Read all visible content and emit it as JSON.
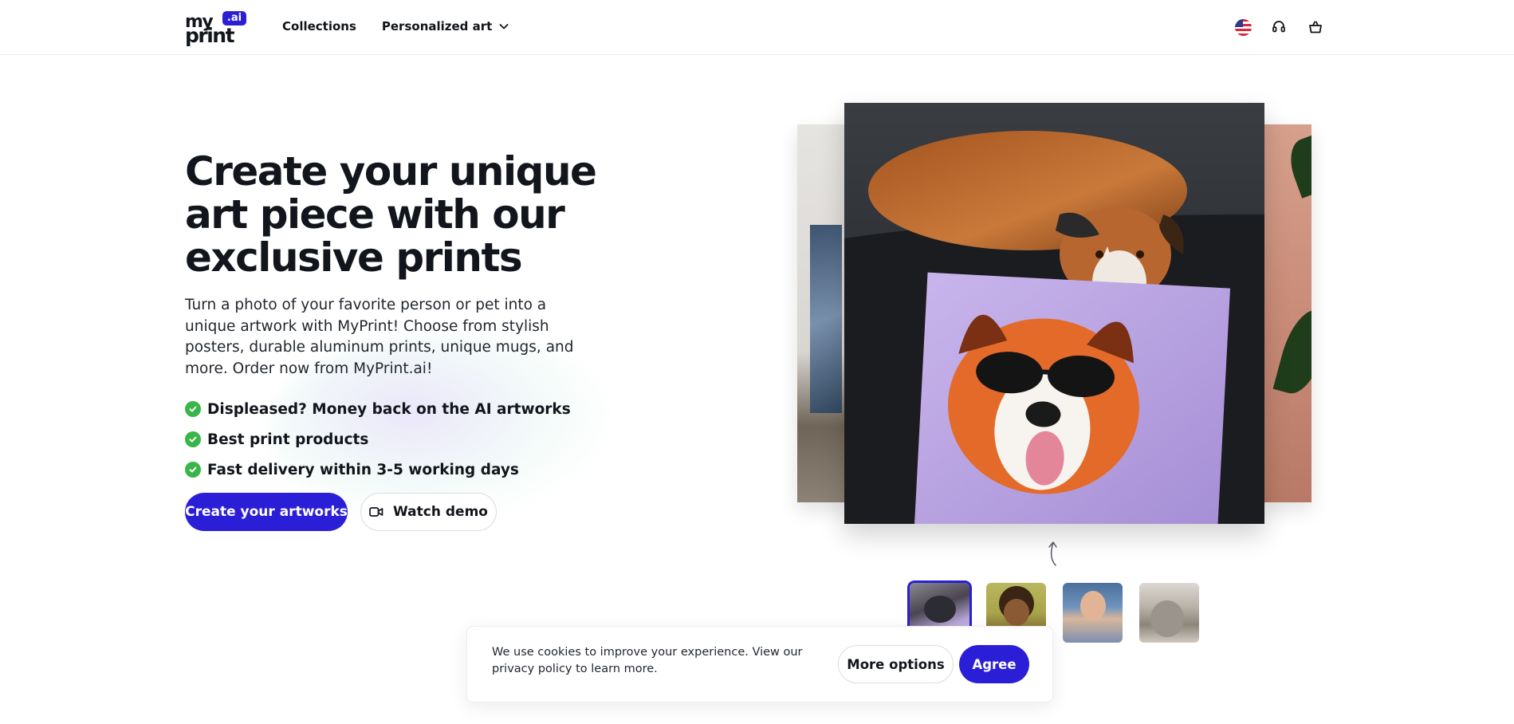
{
  "header": {
    "logo": {
      "top_text": "my",
      "bottom_text": "print",
      "badge": ".ai"
    },
    "nav": [
      {
        "label": "Collections"
      },
      {
        "label": "Personalized art"
      }
    ],
    "icons": [
      "us-flag-icon",
      "headset-icon",
      "cart-icon"
    ]
  },
  "hero": {
    "title": "Create your unique art piece with our exclusive prints",
    "description": "Turn a photo of your favorite person or pet into a unique artwork with MyPrint! Choose from stylish posters, durable aluminum prints, unique mugs, and more. Order now from MyPrint.ai!",
    "features": [
      "Displeased? Money back on the AI artworks",
      "Best print products",
      "Fast delivery within 3-5 working days"
    ],
    "primary_button": "Create your artworks",
    "secondary_button": "Watch demo"
  },
  "gallery": {
    "selected_index": 0,
    "thumbnails": [
      "dog-thumbnail",
      "child-thumbnail",
      "man-thumbnail",
      "cat-thumbnail"
    ]
  },
  "cookie_banner": {
    "text": "We use cookies to improve your experience. View our privacy policy to learn more.",
    "more_button": "More options",
    "agree_button": "Agree"
  },
  "colors": {
    "brand": "#2a1fd6",
    "check": "#39b54a",
    "text": "#12161c"
  }
}
